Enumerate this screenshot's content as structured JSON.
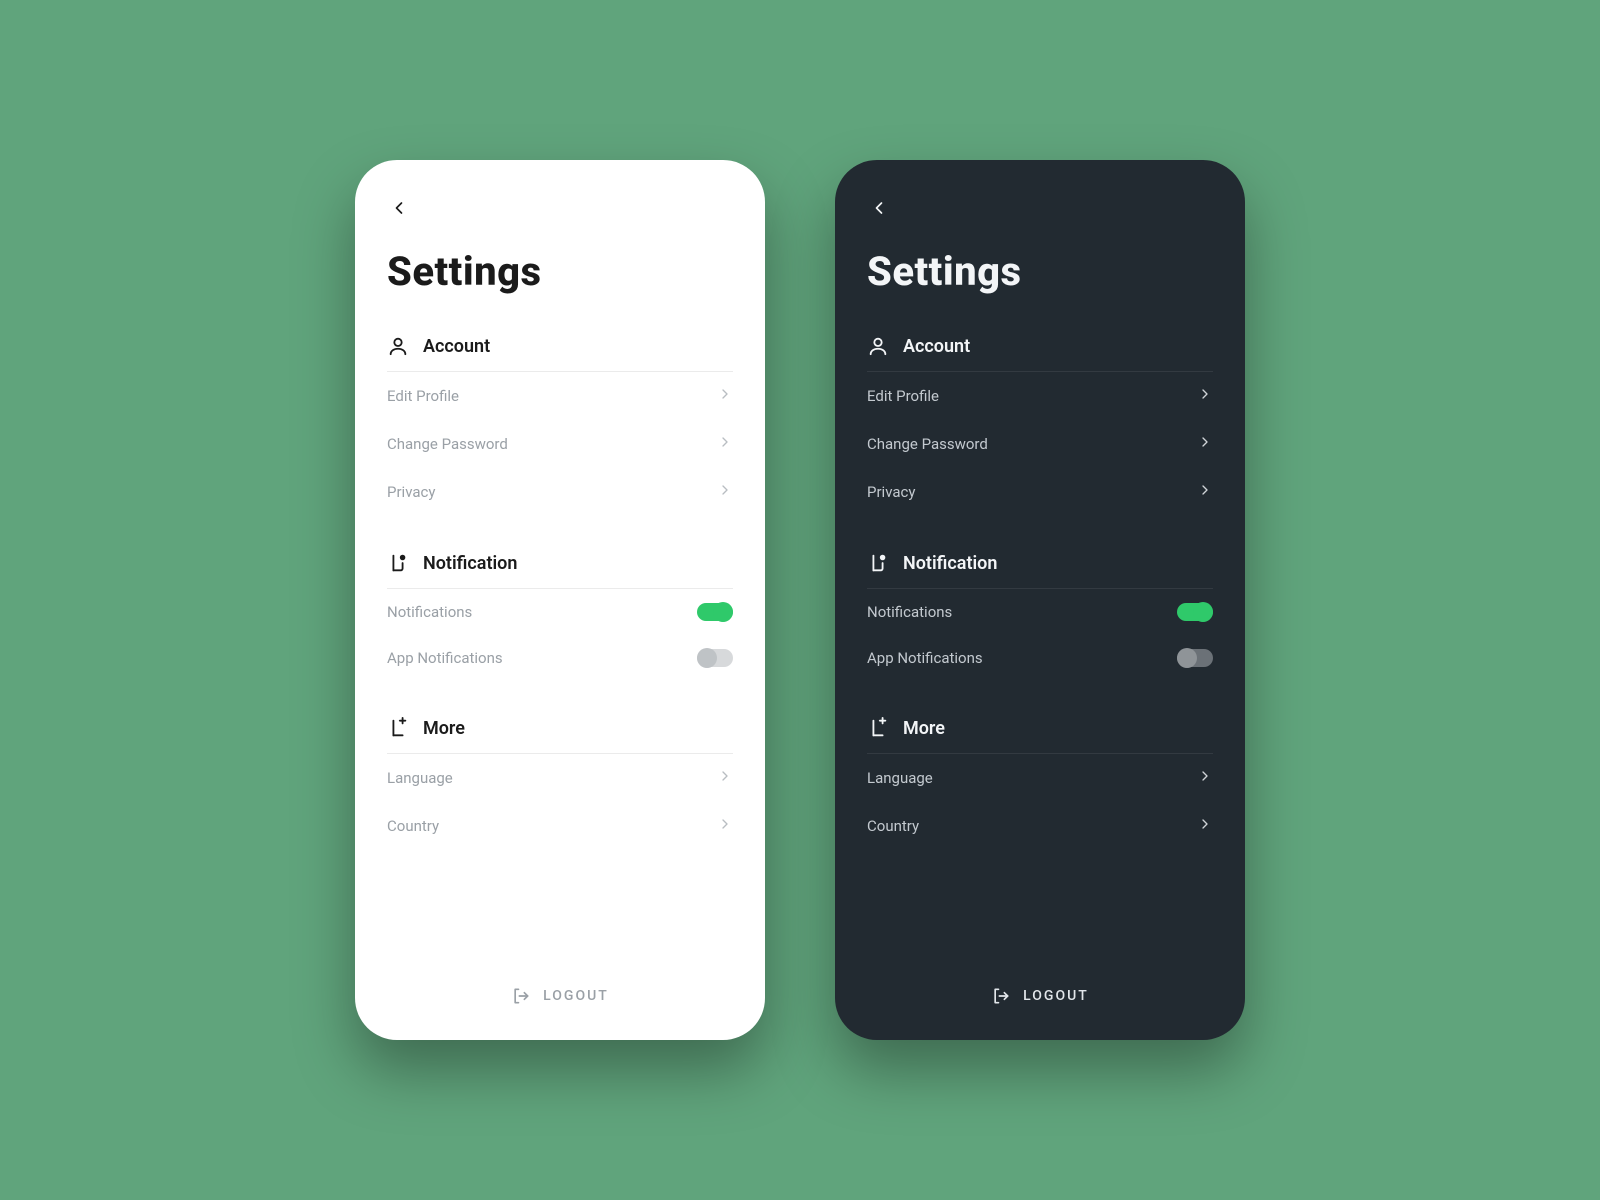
{
  "pageTitle": "Settings",
  "logoutLabel": "LOGOUT",
  "sections": {
    "account": {
      "label": "Account",
      "items": [
        {
          "label": "Edit Profile"
        },
        {
          "label": "Change Password"
        },
        {
          "label": "Privacy"
        }
      ]
    },
    "notification": {
      "label": "Notification",
      "items": [
        {
          "label": "Notifications",
          "toggle": true
        },
        {
          "label": "App Notifications",
          "toggle": false
        }
      ]
    },
    "more": {
      "label": "More",
      "items": [
        {
          "label": "Language"
        },
        {
          "label": "Country"
        }
      ]
    }
  },
  "colors": {
    "background": "#60a47c",
    "accent": "#2fc96a",
    "lightCard": "#ffffff",
    "darkCard": "#222a31"
  }
}
